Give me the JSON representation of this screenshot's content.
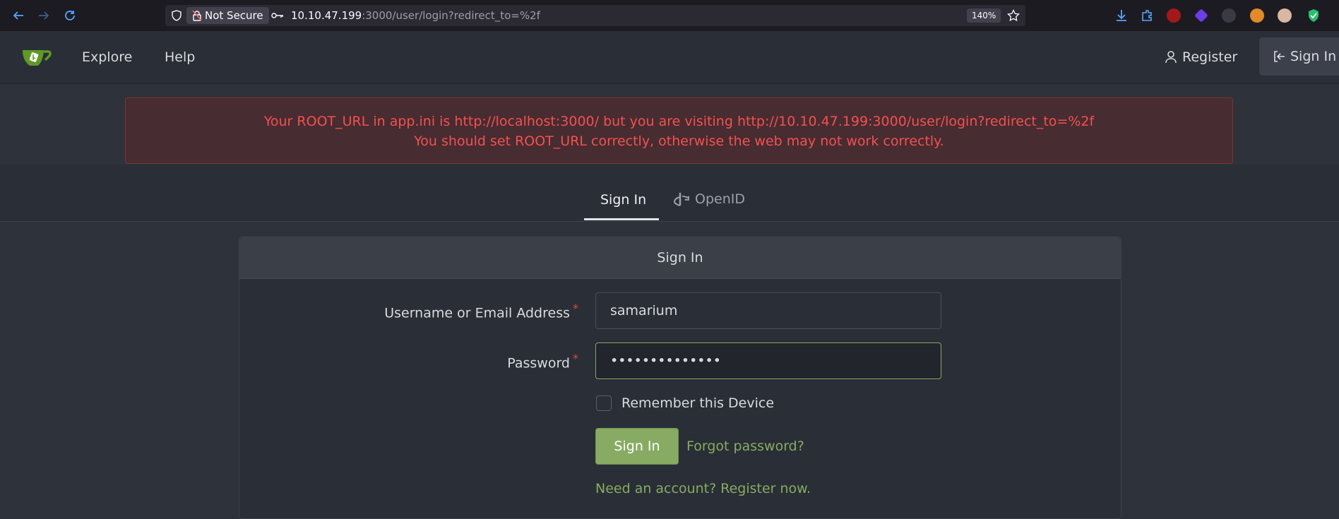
{
  "browser": {
    "not_secure_label": "Not Secure",
    "url_host": "10.10.47.199",
    "url_rest": ":3000/user/login?redirect_to=%2f",
    "zoom": "140%"
  },
  "nav": {
    "explore": "Explore",
    "help": "Help",
    "register": "Register",
    "sign_in": "Sign In"
  },
  "warning": {
    "line1": "Your ROOT_URL in app.ini is http://localhost:3000/ but you are visiting http://10.10.47.199:3000/user/login?redirect_to=%2f",
    "line2": "You should set ROOT_URL correctly, otherwise the web may not work correctly."
  },
  "tabs": {
    "sign_in": "Sign In",
    "openid": "OpenID"
  },
  "form": {
    "title": "Sign In",
    "username_label": "Username or Email Address",
    "username_value": "samarium",
    "password_label": "Password",
    "password_value": "••••••••••••••",
    "required_mark": "*",
    "remember_label": "Remember this Device",
    "submit_label": "Sign In",
    "forgot_link": "Forgot password?",
    "register_link": "Need an account? Register now."
  },
  "colors": {
    "accent": "#87ab63",
    "error_text": "#f5504f",
    "error_bg": "#472c31"
  }
}
